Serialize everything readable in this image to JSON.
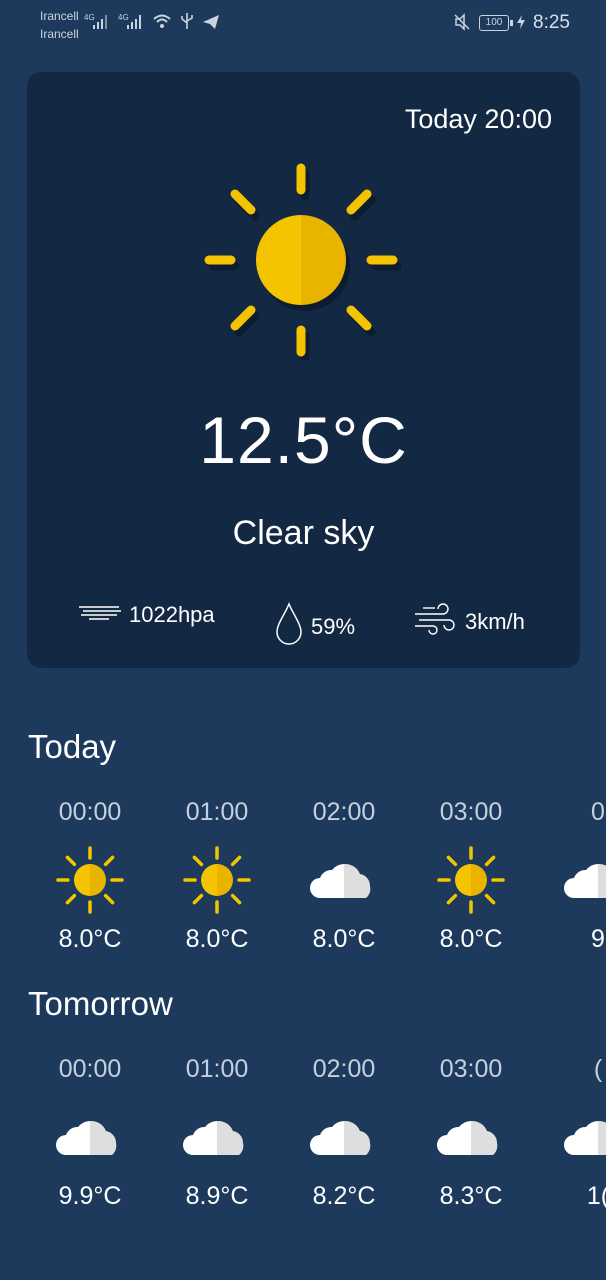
{
  "status_bar": {
    "carrier_1": "Irancell",
    "carrier_2": "Irancell",
    "network_1": "4G",
    "network_2": "4G",
    "battery": "100",
    "time": "8:25",
    "icons": [
      "signal-icon",
      "signal-icon",
      "wifi-icon",
      "usb-icon",
      "telegram-icon",
      "mute-icon",
      "battery-icon",
      "charging-icon"
    ]
  },
  "current": {
    "time_label": "Today 20:00",
    "icon": "sun-icon",
    "temperature": "12.5°C",
    "condition": "Clear sky",
    "pressure": "1022hpa",
    "humidity": "59%",
    "wind": "3km/h"
  },
  "today": {
    "title": "Today",
    "hours": [
      {
        "time": "00:00",
        "icon": "sun",
        "temp": "8.0°C"
      },
      {
        "time": "01:00",
        "icon": "sun",
        "temp": "8.0°C"
      },
      {
        "time": "02:00",
        "icon": "cloud",
        "temp": "8.0°C"
      },
      {
        "time": "03:00",
        "icon": "sun",
        "temp": "8.0°C"
      },
      {
        "time": "0",
        "icon": "cloud",
        "temp": "9"
      }
    ]
  },
  "tomorrow": {
    "title": "Tomorrow",
    "hours": [
      {
        "time": "00:00",
        "icon": "cloud",
        "temp": "9.9°C"
      },
      {
        "time": "01:00",
        "icon": "cloud",
        "temp": "8.9°C"
      },
      {
        "time": "02:00",
        "icon": "cloud",
        "temp": "8.2°C"
      },
      {
        "time": "03:00",
        "icon": "cloud",
        "temp": "8.3°C"
      },
      {
        "time": "(",
        "icon": "cloud",
        "temp": "1("
      }
    ]
  },
  "colors": {
    "background": "#1d3a5c",
    "card": "#132842",
    "sun": "#f5c400",
    "sun_shade": "#e8b400",
    "cloud": "#ffffff",
    "cloud_shade": "#dedede"
  }
}
